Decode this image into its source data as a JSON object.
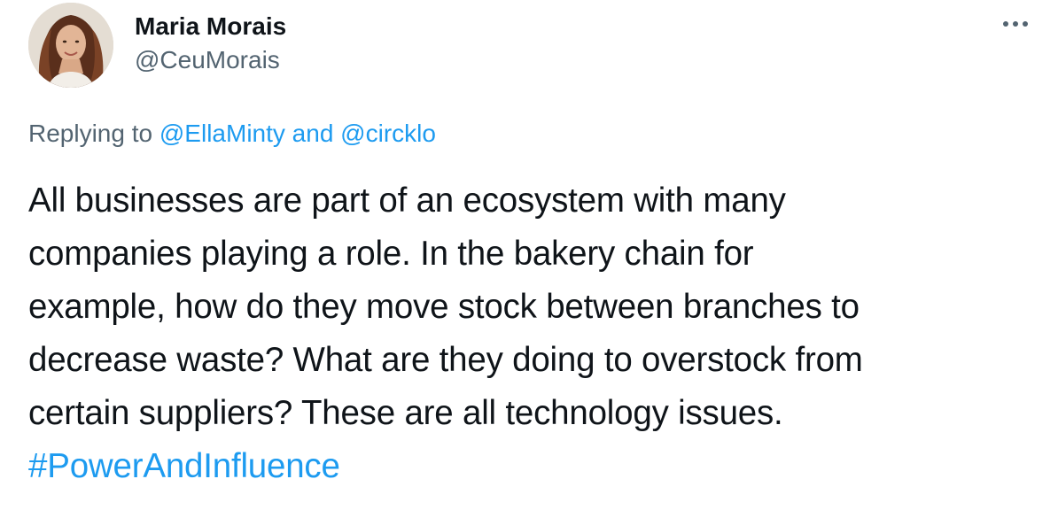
{
  "author": {
    "display_name": "Maria Morais",
    "handle": "@CeuMorais",
    "avatar_icon": "profile-photo"
  },
  "menu": {
    "icon": "more-horizontal-icon"
  },
  "reply_context": {
    "prefix": "Replying to",
    "mentions": [
      "@EllaMinty",
      "@circklo"
    ],
    "joiner": "and"
  },
  "tweet": {
    "lines": [
      "All businesses are part of an ecosystem with many",
      "companies playing a role. In the bakery chain for",
      "example, how do they move stock between branches to",
      "decrease waste? What are they doing to overstock from",
      "certain suppliers? These are all technology issues."
    ],
    "hashtag": "#PowerAndInfluence"
  },
  "colors": {
    "link": "#1d9bf0",
    "secondary_text": "#536471",
    "primary_text": "#0f1419"
  }
}
